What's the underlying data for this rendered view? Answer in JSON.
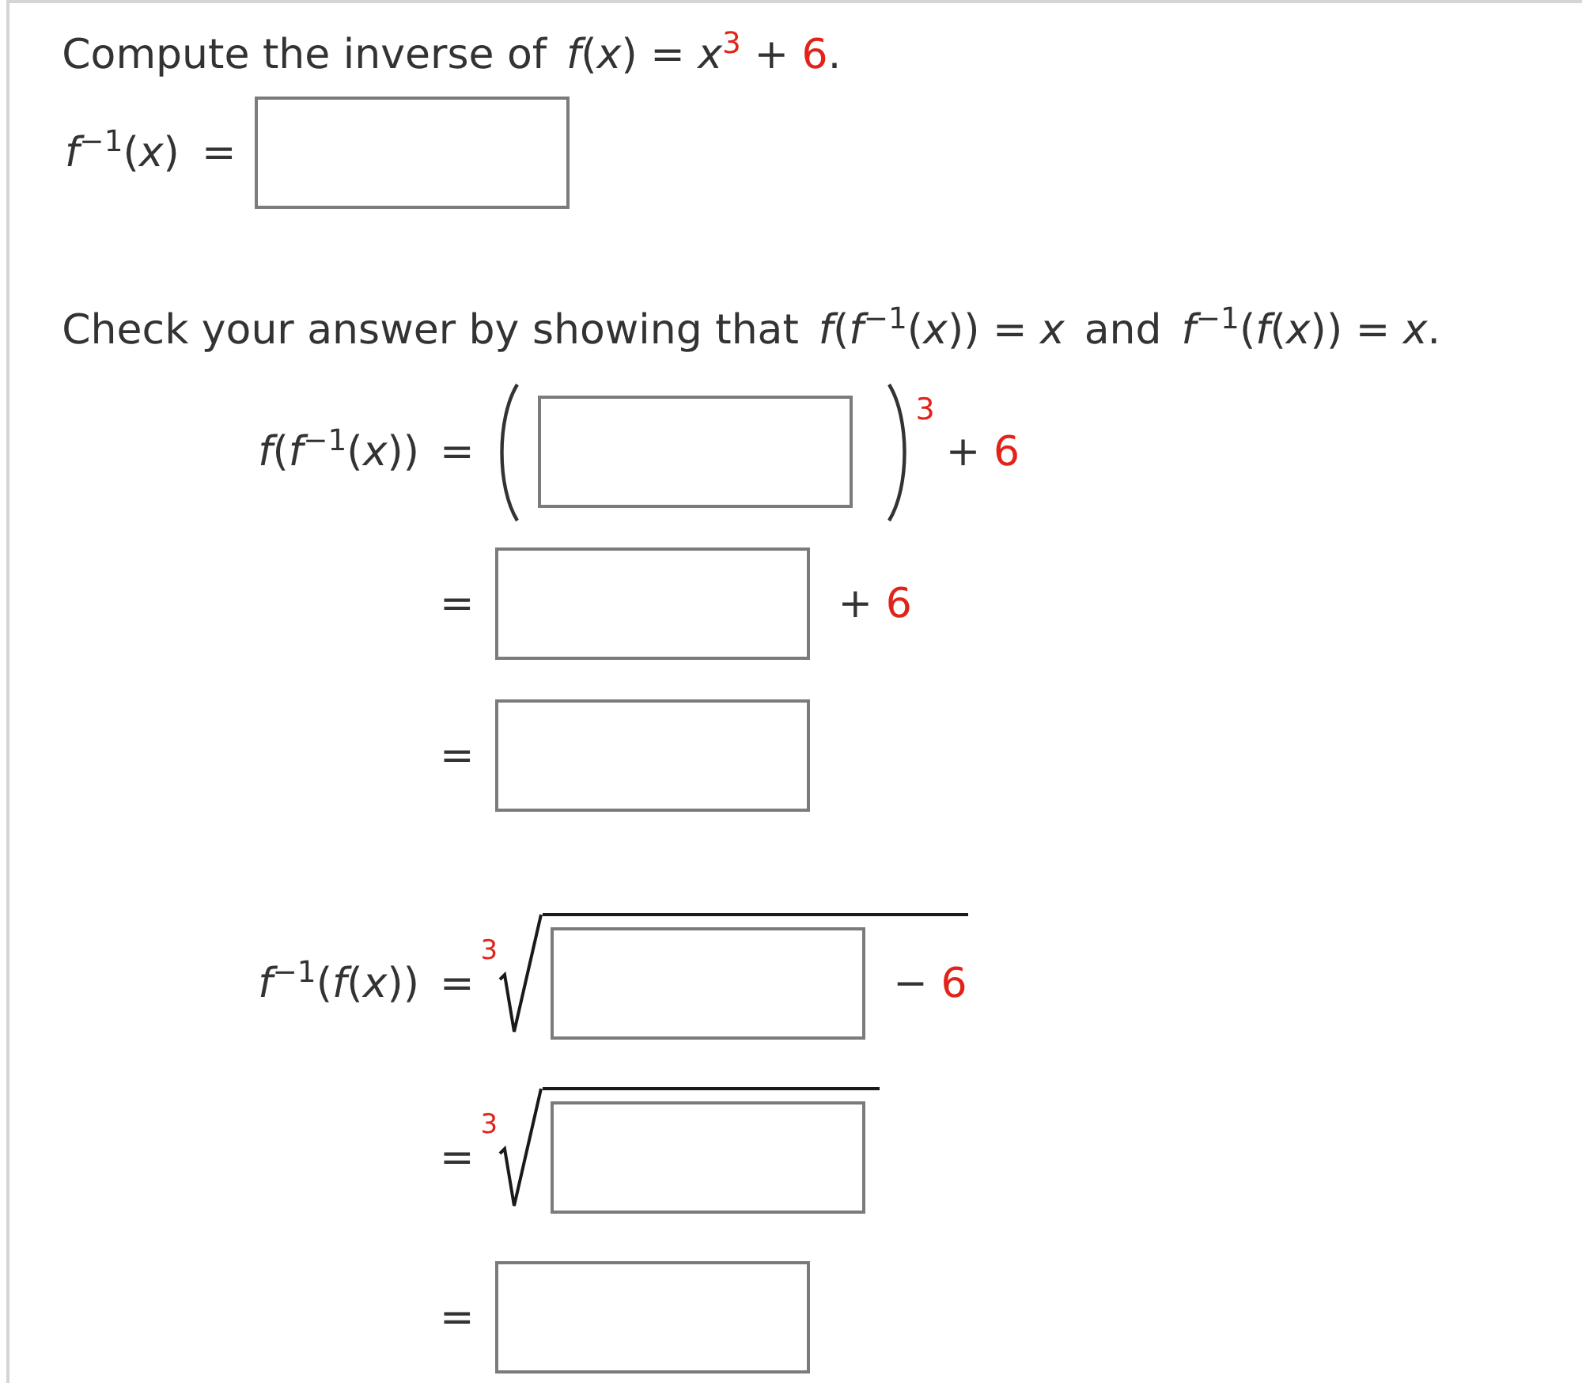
{
  "question": {
    "prompt": [
      {
        "kind": "text",
        "text": "Compute the inverse of"
      },
      {
        "kind": "math",
        "text": "*f*(*x*) = *x*"
      },
      {
        "kind": "given_power",
        "text": "3"
      },
      {
        "kind": "math",
        "text": "+"
      },
      {
        "kind": "given",
        "text": "6"
      },
      {
        "kind": "punct",
        "text": "."
      }
    ],
    "answer": {
      "label": "*f*$^{−1}$(*x*)",
      "relation": "="
    }
  },
  "check": {
    "prompt": [
      {
        "kind": "text",
        "text": "Check your answer by showing that"
      },
      {
        "kind": "math",
        "text": "*f*(*f*$^{−1}$(*x*)) = *x*"
      },
      {
        "kind": "text",
        "text": "and"
      },
      {
        "kind": "math",
        "text": "*f*$^{−1}$(*f*(*x*)) = *x*"
      },
      {
        "kind": "punct",
        "text": "."
      }
    ],
    "derivations": [
      {
        "label": "*f*(*f*$^{−1}$(*x*))",
        "steps": [
          {
            "kind": "power",
            "relation": "=",
            "exponent": "3",
            "operator": "+",
            "constant": "6"
          },
          {
            "kind": "box",
            "relation": "=",
            "operator": "+",
            "constant": "6"
          },
          {
            "kind": "box",
            "relation": "="
          }
        ]
      },
      {
        "label": "*f*$^{−1}$(*f*(*x*))",
        "steps": [
          {
            "kind": "root",
            "relation": "=",
            "index": "3",
            "operator": "−",
            "constant": "6"
          },
          {
            "kind": "root",
            "relation": "=",
            "index": "3"
          },
          {
            "kind": "box",
            "relation": "="
          }
        ]
      }
    ]
  }
}
